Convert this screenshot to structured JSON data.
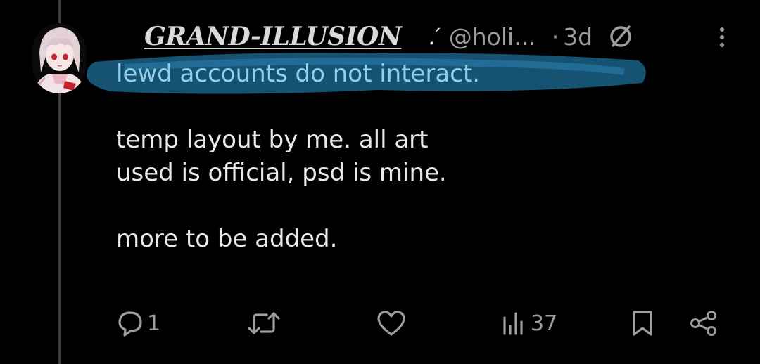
{
  "post": {
    "display_name": "GRAND-ILLUSION",
    "name_symbol": ".′",
    "handle": "@holi...",
    "separator": "·",
    "time": "3d",
    "lines": {
      "highlighted": "lewd accounts do not interact.",
      "line2": "temp layout by me. all art",
      "line3": "used is official, psd is mine.",
      "line4": "more to be added."
    },
    "highlight_color": "#1d6f9a"
  },
  "actions": {
    "reply_count": "1",
    "retweet_count": "",
    "like_count": "",
    "views_count": "37"
  },
  "icons": {
    "avatar": "avatar",
    "null": "null-symbol-icon",
    "more": "more-vertical-icon",
    "reply": "reply-icon",
    "retweet": "retweet-icon",
    "like": "heart-icon",
    "views": "views-bar-chart-icon",
    "bookmark": "bookmark-icon",
    "share": "share-icon"
  }
}
